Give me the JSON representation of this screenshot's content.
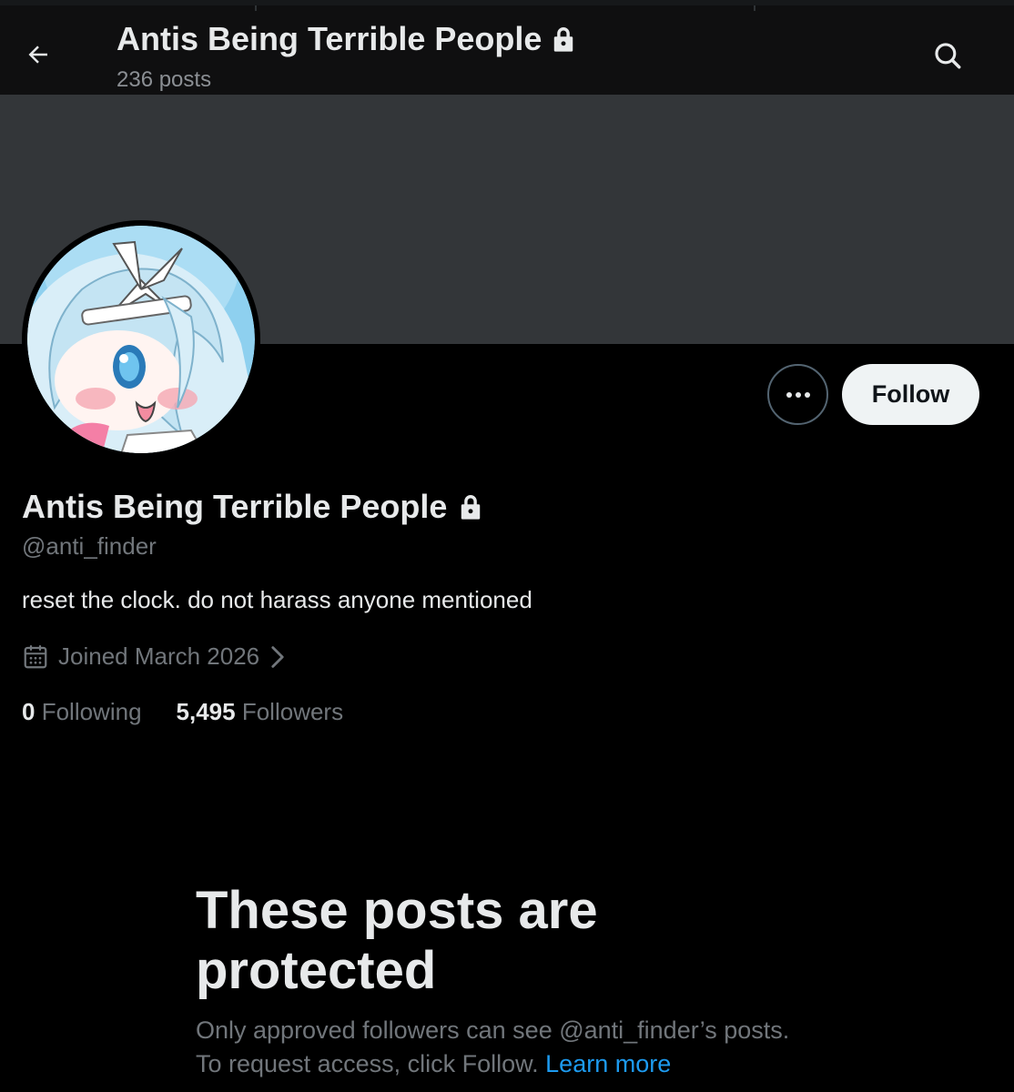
{
  "header": {
    "title": "Antis Being Terrible People",
    "post_count": "236 posts",
    "back_icon": "arrow-left-icon",
    "search_icon": "search-icon",
    "lock_icon": "lock-icon"
  },
  "profile": {
    "display_name": "Antis Being Terrible People",
    "handle": "@anti_finder",
    "bio": "reset the clock. do not harass anyone mentioned",
    "joined": "Joined March 2026",
    "following_count": "0",
    "following_label": "Following",
    "followers_count": "5,495",
    "followers_label": "Followers",
    "avatar_icon": "avatar"
  },
  "actions": {
    "more_icon": "more-icon",
    "follow_label": "Follow"
  },
  "protected": {
    "title": "These posts are protected",
    "desc_text": "Only approved followers can see @anti_finder’s posts. To request access, click Follow. ",
    "learn_more": "Learn more"
  },
  "colors": {
    "background": "#000000",
    "banner": "#333639",
    "text_primary": "#e7e9ea",
    "text_secondary": "#71767b",
    "link": "#1d9bf0",
    "follow_button_bg": "#eff3f4"
  }
}
